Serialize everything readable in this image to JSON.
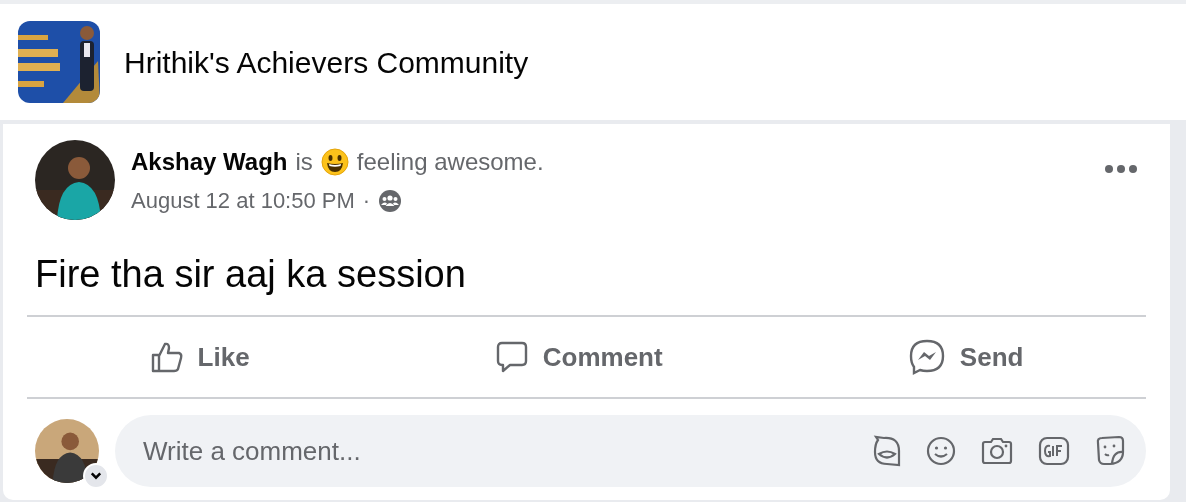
{
  "group": {
    "title": "Hrithik's Achievers Community"
  },
  "post": {
    "author": "Akshay Wagh",
    "verb": "is",
    "feeling": "feeling awesome.",
    "time": "August 12 at 10:50 PM",
    "separator": "·",
    "text": "Fire tha sir aaj ka session"
  },
  "actions": [
    {
      "kind": "like",
      "label": "Like"
    },
    {
      "kind": "comment",
      "label": "Comment"
    },
    {
      "kind": "send",
      "label": "Send"
    }
  ],
  "comment_box": {
    "placeholder": "Write a comment..."
  }
}
